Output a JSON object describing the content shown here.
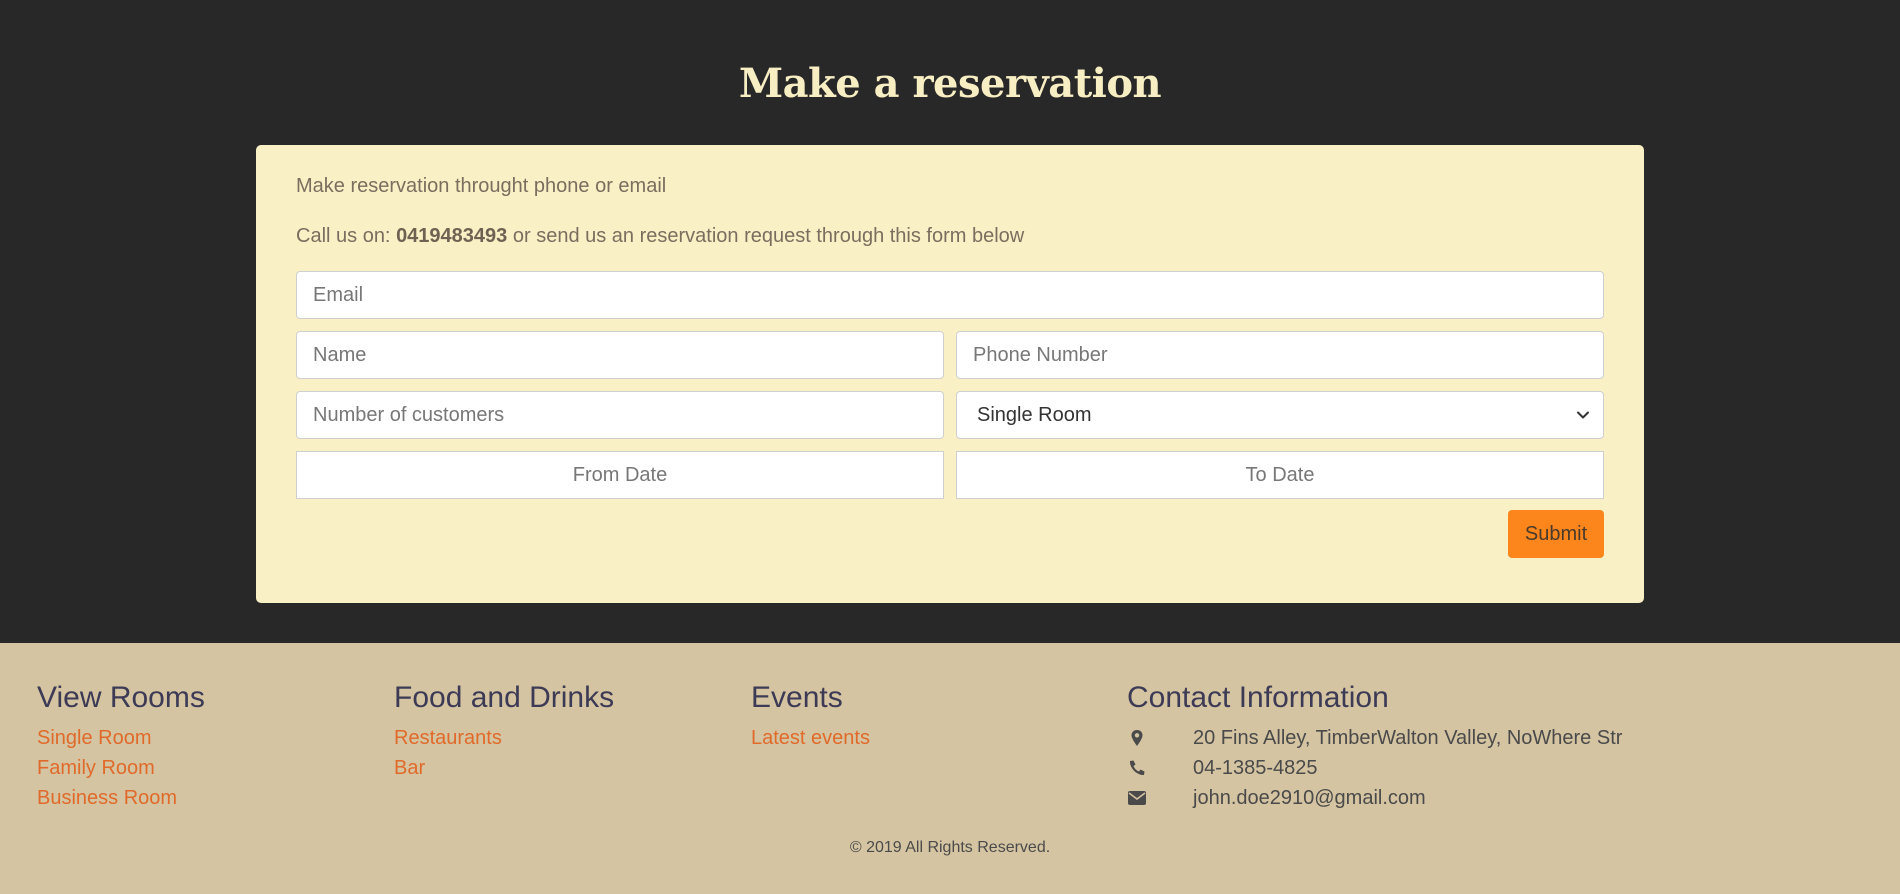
{
  "hero": {
    "title": "Make a reservation"
  },
  "card": {
    "intro": "Make reservation throught phone or email",
    "call_prefix": "Call us on: ",
    "phone": "0419483493",
    "call_suffix": " or send us an reservation request through this form below"
  },
  "form": {
    "email_placeholder": "Email",
    "name_placeholder": "Name",
    "phone_placeholder": "Phone Number",
    "customers_placeholder": "Number of customers",
    "room_selected": "Single Room",
    "from_date_placeholder": "From Date",
    "to_date_placeholder": "To Date",
    "submit_label": "Submit"
  },
  "footer": {
    "rooms": {
      "heading": "View Rooms",
      "links": [
        "Single Room",
        "Family Room",
        "Business Room"
      ]
    },
    "food": {
      "heading": "Food and Drinks",
      "links": [
        "Restaurants",
        "Bar"
      ]
    },
    "events": {
      "heading": "Events",
      "links": [
        "Latest events"
      ]
    },
    "contact": {
      "heading": "Contact Information",
      "address": "20 Fins Alley, TimberWalton Valley, NoWhere Str",
      "phone": "04-1385-4825",
      "email": "john.doe2910@gmail.com"
    },
    "copyright": "© 2019 All Rights Reserved."
  },
  "icons": {
    "address": "map-marker-icon",
    "phone": "phone-icon",
    "email": "envelope-icon",
    "select": "chevron-down-icon"
  },
  "colors": {
    "background": "#282828",
    "title": "#f8eec3",
    "card": "#faf0c6",
    "accent": "#fd861c",
    "footer": "#d5c4a2",
    "link": "#e06a2a",
    "footer_heading": "#3c3a55"
  }
}
